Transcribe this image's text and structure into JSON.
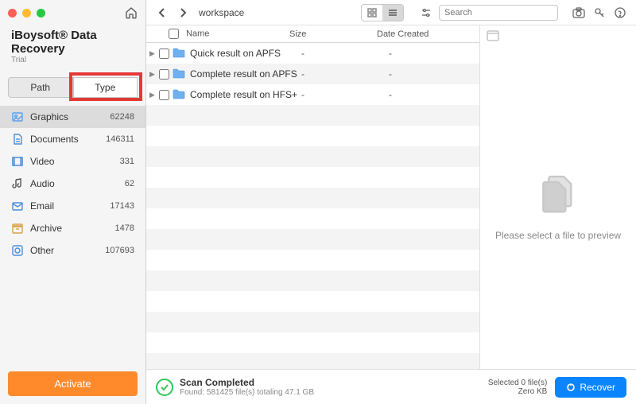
{
  "app": {
    "title": "iBoysoft® Data Recovery",
    "subtitle": "Trial"
  },
  "sidebar_tabs": {
    "path": "Path",
    "type": "Type",
    "active": "type"
  },
  "categories": [
    {
      "name": "Graphics",
      "count": "62248",
      "icon": "image",
      "color": "#5aa0ea",
      "selected": true
    },
    {
      "name": "Documents",
      "count": "146311",
      "icon": "doc",
      "color": "#4a8ed9"
    },
    {
      "name": "Video",
      "count": "331",
      "icon": "video",
      "color": "#4a8ed9"
    },
    {
      "name": "Audio",
      "count": "62",
      "icon": "audio",
      "color": "#555"
    },
    {
      "name": "Email",
      "count": "17143",
      "icon": "mail",
      "color": "#4a8ed9"
    },
    {
      "name": "Archive",
      "count": "1478",
      "icon": "archive",
      "color": "#d9a24a"
    },
    {
      "name": "Other",
      "count": "107693",
      "icon": "other",
      "color": "#4a8ed9"
    }
  ],
  "activate_label": "Activate",
  "toolbar": {
    "crumb": "workspace",
    "search_placeholder": "Search"
  },
  "columns": {
    "name": "Name",
    "size": "Size",
    "date": "Date Created"
  },
  "files": [
    {
      "name": "Quick result on APFS",
      "size": "-",
      "date": "-"
    },
    {
      "name": "Complete result on APFS",
      "size": "-",
      "date": "-"
    },
    {
      "name": "Complete result on HFS+",
      "size": "-",
      "date": "-"
    }
  ],
  "preview_msg": "Please select a file to preview",
  "footer": {
    "status_title": "Scan Completed",
    "status_detail": "Found: 581425 file(s) totaling 47.1 GB",
    "selected_title": "Selected 0 file(s)",
    "selected_detail": "Zero KB",
    "recover_label": "Recover"
  }
}
